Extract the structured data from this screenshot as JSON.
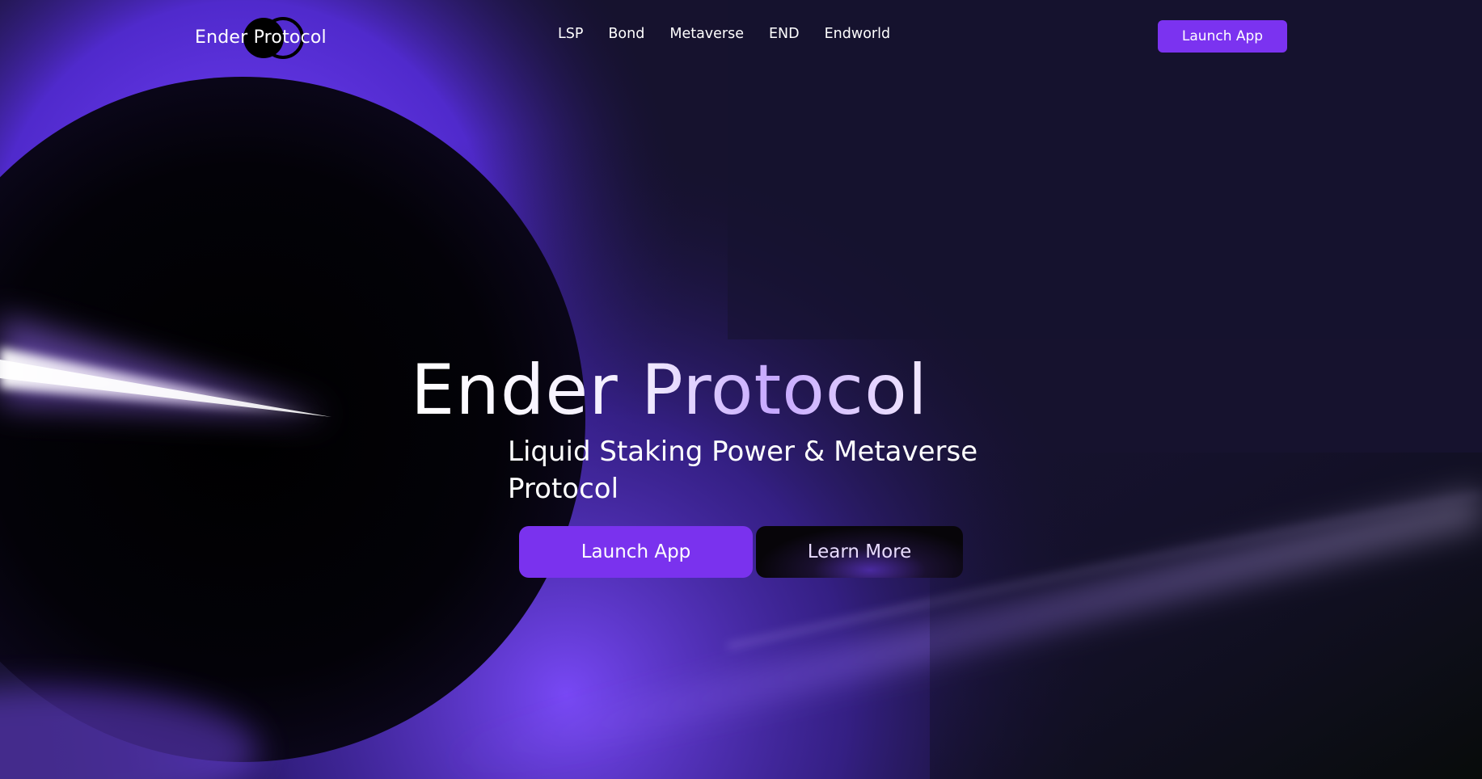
{
  "brand": {
    "name": "Ender Protocol",
    "accent_color": "#7b33f0",
    "logo_icon": "double-ring-logo-icon"
  },
  "nav": {
    "items": [
      {
        "label": "LSP"
      },
      {
        "label": "Bond"
      },
      {
        "label": "Metaverse"
      },
      {
        "label": "END"
      },
      {
        "label": "Endworld"
      }
    ],
    "launch_label": "Launch App"
  },
  "hero": {
    "title": "Ender Protocol",
    "subtitle": "Liquid Staking Power & Metaverse Protocol",
    "primary_label": "Launch App",
    "secondary_label": "Learn More"
  }
}
